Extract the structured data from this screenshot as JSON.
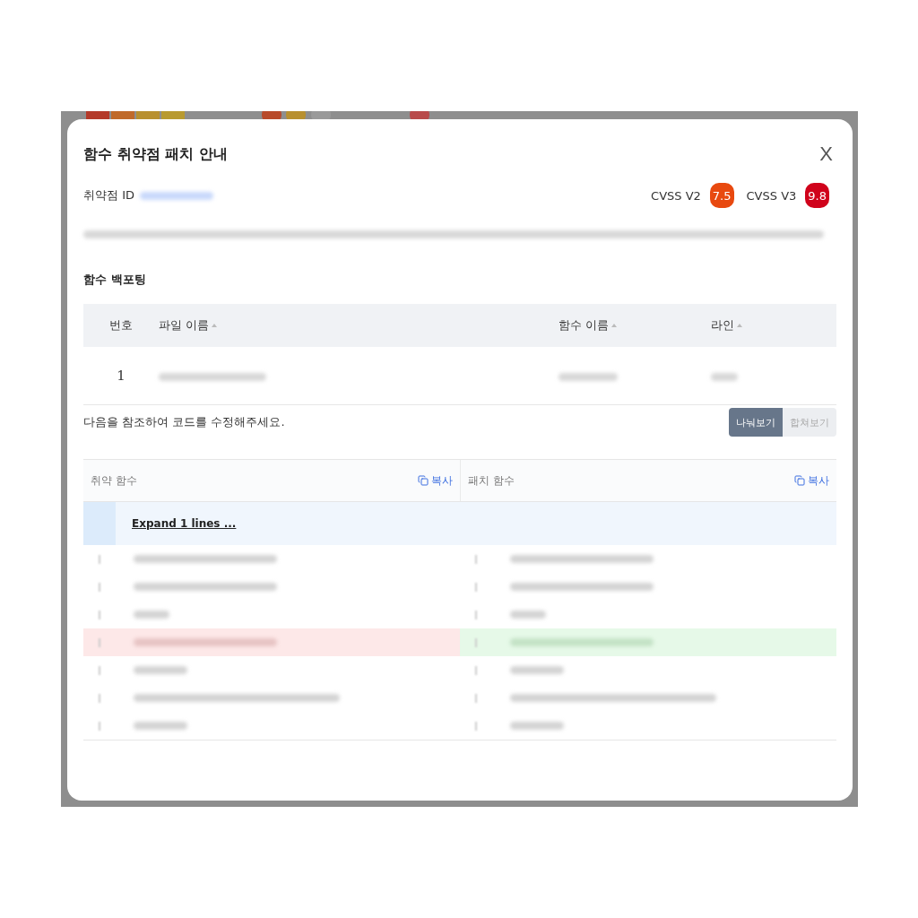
{
  "dialog": {
    "title": "함수 취약점 패치 안내",
    "close": "X"
  },
  "vulnerability": {
    "label": "취약점 ID",
    "cvss": [
      {
        "label": "CVSS V2",
        "score": "7.5",
        "color": "#e8490f"
      },
      {
        "label": "CVSS V3",
        "score": "9.8",
        "color": "#d0021b"
      }
    ]
  },
  "section_title": "함수 백포팅",
  "table": {
    "columns": [
      {
        "label": "번호",
        "sortable": false
      },
      {
        "label": "파일 이름",
        "sortable": true
      },
      {
        "label": "함수 이름",
        "sortable": true
      },
      {
        "label": "라인",
        "sortable": true
      }
    ],
    "rows": [
      {
        "number": "1"
      }
    ]
  },
  "instruction": "다음을 참조하여 코드를 수정해주세요.",
  "view_toggle": [
    {
      "label": "나눠보기",
      "selected": true
    },
    {
      "label": "합쳐보기",
      "selected": false
    }
  ],
  "diff": {
    "panes": [
      {
        "title": "취약 함수",
        "copy": "복사"
      },
      {
        "title": "패치 함수",
        "copy": "복사"
      }
    ],
    "expand": "Expand 1 lines ...",
    "lines": [
      {
        "kind": "context"
      },
      {
        "kind": "context"
      },
      {
        "kind": "context"
      },
      {
        "kind": "changed"
      },
      {
        "kind": "context"
      },
      {
        "kind": "context"
      },
      {
        "kind": "context"
      }
    ]
  }
}
